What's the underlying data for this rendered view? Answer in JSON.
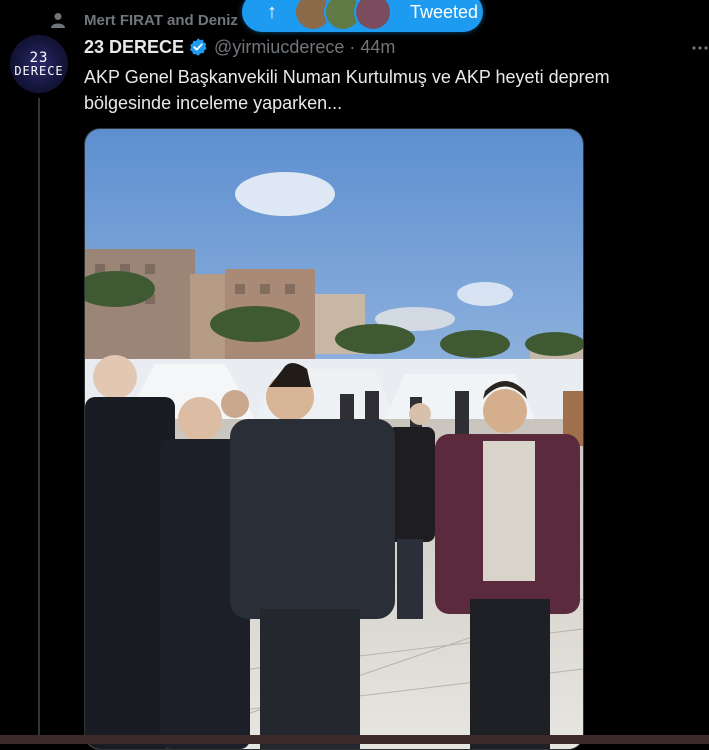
{
  "social_context": {
    "text": "Mert FIRAT and Deniz"
  },
  "new_tweets_pill": {
    "label": "Tweeted"
  },
  "tweet": {
    "author": {
      "display_name": "23 DERECE",
      "handle": "@yirmiucderece",
      "avatar_top": "23",
      "avatar_bottom": "DERECE",
      "verified": true
    },
    "time": "44m",
    "text": "AKP Genel Başkanvekili Numan Kurtulmuş ve AKP heyeti deprem bölgesinde inceleme yaparken..."
  },
  "colors": {
    "background": "#000000",
    "accent": "#1d9bf0",
    "muted": "#71767b",
    "text": "#e7e9ea"
  }
}
